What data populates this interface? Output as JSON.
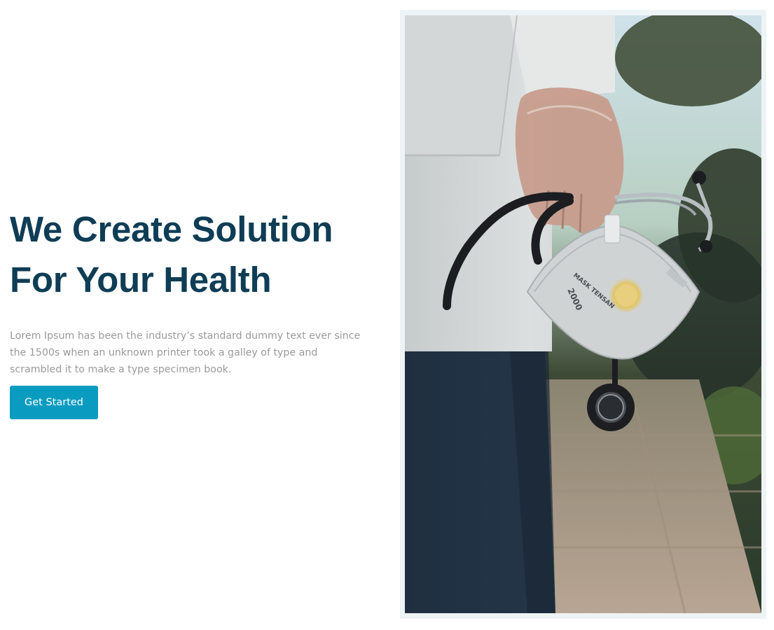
{
  "hero": {
    "title_line1": "We Create Solution",
    "title_line2": "For Your Health",
    "description": "Lorem Ipsum has been the industry’s standard dummy text ever since the 1500s when an unknown printer took a galley of type and scrambled it to make a type specimen book.",
    "cta_label": "Get Started"
  },
  "photo": {
    "mask_print_1": "MASK TENSAN",
    "mask_print_2": "2000"
  },
  "colors": {
    "title": "#0f3d55",
    "body_text": "#9a9a9a",
    "button": "#0a9cc0",
    "frame": "#eef3f5"
  }
}
